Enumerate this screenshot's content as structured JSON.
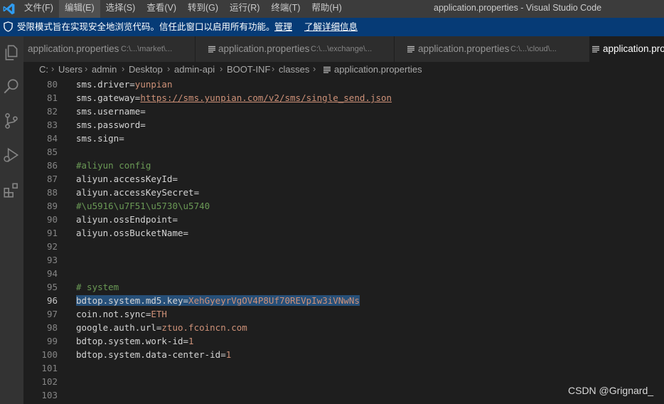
{
  "menu": {
    "items": [
      "文件(F)",
      "编辑(E)",
      "选择(S)",
      "查看(V)",
      "转到(G)",
      "运行(R)",
      "终端(T)",
      "帮助(H)"
    ],
    "active_index": 1
  },
  "window_title": "application.properties - Visual Studio Code",
  "banner": {
    "message": "受限模式旨在实现安全地浏览代码。信任此窗口以启用所有功能。",
    "manage_link": "管理",
    "learn_more_link": "了解详细信息"
  },
  "tabs": [
    {
      "label": "application.properties",
      "description": "C:\\...\\market\\..."
    },
    {
      "label": "application.properties",
      "description": "C:\\...\\exchange\\..."
    },
    {
      "label": "application.properties",
      "description": "C:\\...\\cloud\\..."
    },
    {
      "label": "application.pro",
      "description": ""
    }
  ],
  "breadcrumb": [
    "C:",
    "Users",
    "admin",
    "Desktop",
    "admin-api",
    "BOOT-INF",
    "classes",
    "application.properties"
  ],
  "editor": {
    "current_line": 96,
    "lines": [
      {
        "n": "80",
        "segs": [
          {
            "t": "sms.driver=",
            "c": "k"
          },
          {
            "t": "yunpian",
            "c": "v"
          }
        ]
      },
      {
        "n": "81",
        "segs": [
          {
            "t": "sms.gateway=",
            "c": "k"
          },
          {
            "t": "https://sms.yunpian.com/v2/sms/single_send.json",
            "c": "u"
          }
        ]
      },
      {
        "n": "82",
        "segs": [
          {
            "t": "sms.username=",
            "c": "k"
          }
        ]
      },
      {
        "n": "83",
        "segs": [
          {
            "t": "sms.password=",
            "c": "k"
          }
        ]
      },
      {
        "n": "84",
        "segs": [
          {
            "t": "sms.sign=",
            "c": "k"
          }
        ]
      },
      {
        "n": "85",
        "segs": []
      },
      {
        "n": "86",
        "segs": [
          {
            "t": "#aliyun config",
            "c": "c"
          }
        ]
      },
      {
        "n": "87",
        "segs": [
          {
            "t": "aliyun.accessKeyId=",
            "c": "k"
          }
        ]
      },
      {
        "n": "88",
        "segs": [
          {
            "t": "aliyun.accessKeySecret=",
            "c": "k"
          }
        ]
      },
      {
        "n": "89",
        "segs": [
          {
            "t": "#\\u5916\\u7F51\\u5730\\u5740",
            "c": "c"
          }
        ]
      },
      {
        "n": "90",
        "segs": [
          {
            "t": "aliyun.ossEndpoint=",
            "c": "k"
          }
        ]
      },
      {
        "n": "91",
        "segs": [
          {
            "t": "aliyun.ossBucketName=",
            "c": "k"
          }
        ]
      },
      {
        "n": "92",
        "segs": []
      },
      {
        "n": "93",
        "segs": []
      },
      {
        "n": "94",
        "segs": []
      },
      {
        "n": "95",
        "segs": [
          {
            "t": "# system",
            "c": "c"
          }
        ]
      },
      {
        "n": "96",
        "segs": [
          {
            "t": "bdtop.system.md5.key=",
            "c": "k sel"
          },
          {
            "t": "XehGyeyrVgOV4P8Uf70REVpIw3iVNwNs",
            "c": "v sel"
          }
        ]
      },
      {
        "n": "97",
        "segs": [
          {
            "t": "coin.not.sync=",
            "c": "k"
          },
          {
            "t": "ETH",
            "c": "v"
          }
        ]
      },
      {
        "n": "98",
        "segs": [
          {
            "t": "google.auth.url=",
            "c": "k"
          },
          {
            "t": "ztuo.fcoincn.com",
            "c": "v"
          }
        ]
      },
      {
        "n": "99",
        "segs": [
          {
            "t": "bdtop.system.work-id=",
            "c": "k"
          },
          {
            "t": "1",
            "c": "v"
          }
        ]
      },
      {
        "n": "100",
        "segs": [
          {
            "t": "bdtop.system.data-center-id=",
            "c": "k"
          },
          {
            "t": "1",
            "c": "v"
          }
        ]
      },
      {
        "n": "101",
        "segs": []
      },
      {
        "n": "102",
        "segs": []
      },
      {
        "n": "103",
        "segs": []
      }
    ]
  },
  "watermark": "CSDN @Grignard_",
  "colors": {
    "titlebar": "#3c3c3c",
    "banner": "#063b76",
    "activitybar": "#333333",
    "editor": "#1e1e1e",
    "selection": "#264f78",
    "key": "#d4d4d4",
    "value": "#ce9178",
    "comment": "#6a9955"
  }
}
